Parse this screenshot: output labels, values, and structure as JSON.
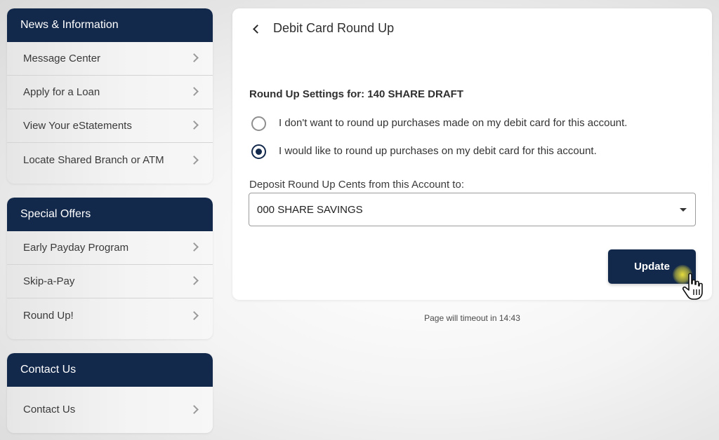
{
  "sidebar": {
    "panels": [
      {
        "header": "News & Information",
        "items": [
          "Message Center",
          "Apply for a Loan",
          "View Your eStatements",
          "Locate Shared Branch or ATM"
        ]
      },
      {
        "header": "Special Offers",
        "items": [
          "Early Payday Program",
          "Skip-a-Pay",
          "Round Up!"
        ]
      },
      {
        "header": "Contact Us",
        "items": [
          "Contact Us"
        ]
      }
    ]
  },
  "main": {
    "title": "Debit Card Round Up",
    "settings_label": "Round Up Settings for: 140 SHARE DRAFT",
    "options": [
      {
        "label": "I don't want to round up purchases made on my debit card for this account.",
        "checked": false
      },
      {
        "label": "I would like to round up purchases on my debit card for this account.",
        "checked": true
      }
    ],
    "deposit_label": "Deposit Round Up Cents from this Account to:",
    "deposit_selected": "000 SHARE SAVINGS",
    "update_label": "Update"
  },
  "footer": {
    "timeout_text": "Page will timeout in 14:43"
  },
  "colors": {
    "brand_navy": "#13294b"
  }
}
